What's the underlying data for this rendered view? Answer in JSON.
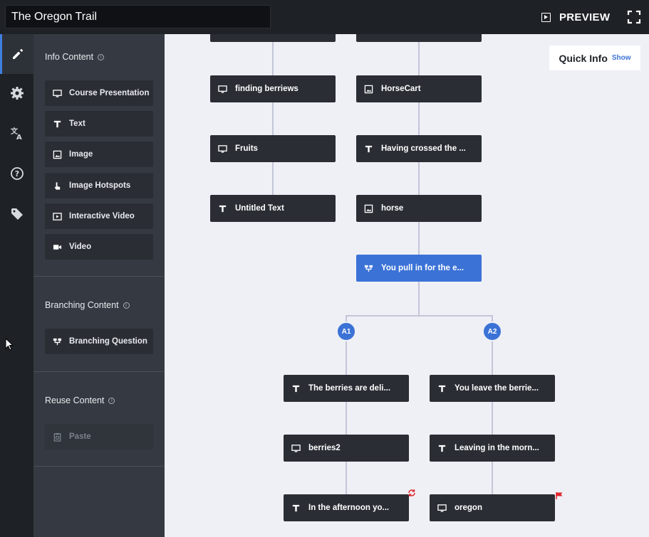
{
  "header": {
    "title_value": "The Oregon Trail",
    "preview_label": "PREVIEW"
  },
  "rail": {
    "items": [
      {
        "name": "edit-icon",
        "active": true
      },
      {
        "name": "gear-icon",
        "active": false
      },
      {
        "name": "translate-icon",
        "active": false
      },
      {
        "name": "help-icon",
        "active": false
      },
      {
        "name": "tag-icon",
        "active": false
      }
    ]
  },
  "panel": {
    "info_content": {
      "title": "Info Content",
      "items": [
        {
          "label": "Course Presentation",
          "icon": "presentation-icon"
        },
        {
          "label": "Text",
          "icon": "text-icon"
        },
        {
          "label": "Image",
          "icon": "image-icon"
        },
        {
          "label": "Image Hotspots",
          "icon": "hotspot-icon"
        },
        {
          "label": "Interactive Video",
          "icon": "interactive-video-icon"
        },
        {
          "label": "Video",
          "icon": "video-icon"
        }
      ]
    },
    "branching_content": {
      "title": "Branching Content",
      "items": [
        {
          "label": "Branching Question",
          "icon": "branching-icon"
        }
      ]
    },
    "reuse_content": {
      "title": "Reuse Content",
      "items": [
        {
          "label": "Paste",
          "icon": "paste-icon"
        }
      ]
    }
  },
  "canvas": {
    "quick_info": {
      "title": "Quick Info",
      "toggle": "Show"
    },
    "nodes": {
      "finding_berriews": "finding berriews",
      "horsecart": "HorseCart",
      "fruits": "Fruits",
      "having_crossed": "Having crossed the ...",
      "untitled_text": "Untitled Text",
      "horse": "horse",
      "you_pull_in": "You pull in for the e...",
      "berries_deli": "The berries are deli...",
      "you_leave": "You leave the berrie...",
      "berries2": "berries2",
      "leaving_morn": "Leaving in the morn...",
      "afternoon": "In the afternoon yo...",
      "oregon": "oregon"
    },
    "badges": {
      "a1": "A1",
      "a2": "A2"
    },
    "colors": {
      "accent": "#3b72d6",
      "flag": "#e0242c",
      "loop": "#e0242c"
    }
  }
}
